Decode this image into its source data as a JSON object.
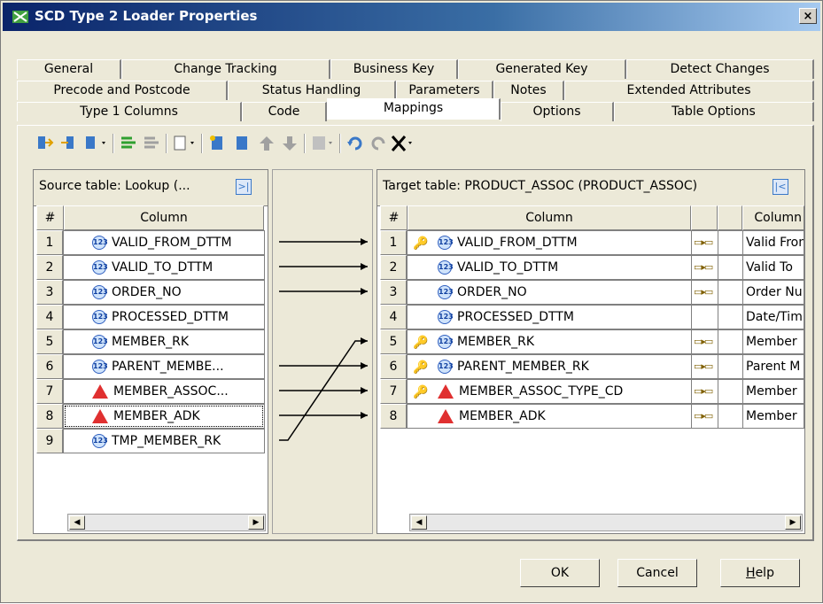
{
  "window": {
    "title": "SCD Type 2 Loader Properties",
    "close": "×"
  },
  "tabs": {
    "row1": [
      "General",
      "Change Tracking",
      "Business Key",
      "Generated Key",
      "Detect Changes"
    ],
    "row2": [
      "Precode and Postcode",
      "Status Handling",
      "Parameters",
      "Notes",
      "Extended Attributes"
    ],
    "row3": [
      "Type 1 Columns",
      "Code",
      "Mappings",
      "Options",
      "Table Options"
    ]
  },
  "source": {
    "title": "Source table: Lookup (...",
    "col_num": "#",
    "col_name": "Column",
    "rows": [
      {
        "n": "1",
        "name": "VALID_FROM_DTTM",
        "type": "num"
      },
      {
        "n": "2",
        "name": "VALID_TO_DTTM",
        "type": "num"
      },
      {
        "n": "3",
        "name": "ORDER_NO",
        "type": "num"
      },
      {
        "n": "4",
        "name": "PROCESSED_DTTM",
        "type": "num"
      },
      {
        "n": "5",
        "name": "MEMBER_RK",
        "type": "num"
      },
      {
        "n": "6",
        "name": "PARENT_MEMBE...",
        "type": "num"
      },
      {
        "n": "7",
        "name": "MEMBER_ASSOC...",
        "type": "char"
      },
      {
        "n": "8",
        "name": "MEMBER_ADK",
        "type": "char"
      },
      {
        "n": "9",
        "name": "TMP_MEMBER_RK",
        "type": "num"
      }
    ]
  },
  "target": {
    "title": "Target table: PRODUCT_ASSOC (PRODUCT_ASSOC)",
    "col_num": "#",
    "col_name": "Column",
    "col_desc": "Column",
    "rows": [
      {
        "n": "1",
        "name": "VALID_FROM_DTTM",
        "type": "num",
        "key": true,
        "mapped": true,
        "desc": "Valid From"
      },
      {
        "n": "2",
        "name": "VALID_TO_DTTM",
        "type": "num",
        "key": false,
        "mapped": true,
        "desc": "Valid To"
      },
      {
        "n": "3",
        "name": "ORDER_NO",
        "type": "num",
        "key": false,
        "mapped": true,
        "desc": "Order Nu"
      },
      {
        "n": "4",
        "name": "PROCESSED_DTTM",
        "type": "num",
        "key": false,
        "mapped": false,
        "desc": "Date/Tim"
      },
      {
        "n": "5",
        "name": "MEMBER_RK",
        "type": "num",
        "key": true,
        "mapped": true,
        "desc": "Member"
      },
      {
        "n": "6",
        "name": "PARENT_MEMBER_RK",
        "type": "num",
        "key": true,
        "mapped": true,
        "desc": "Parent M"
      },
      {
        "n": "7",
        "name": "MEMBER_ASSOC_TYPE_CD",
        "type": "char",
        "key": true,
        "mapped": true,
        "desc": "Member"
      },
      {
        "n": "8",
        "name": "MEMBER_ADK",
        "type": "char",
        "key": false,
        "mapped": true,
        "desc": "Member"
      }
    ]
  },
  "mappings": [
    [
      1,
      1
    ],
    [
      2,
      2
    ],
    [
      3,
      3
    ],
    [
      6,
      6
    ],
    [
      7,
      7
    ],
    [
      8,
      8
    ],
    [
      9,
      5
    ]
  ],
  "buttons": {
    "ok": "OK",
    "cancel": "Cancel",
    "help": "Help"
  }
}
